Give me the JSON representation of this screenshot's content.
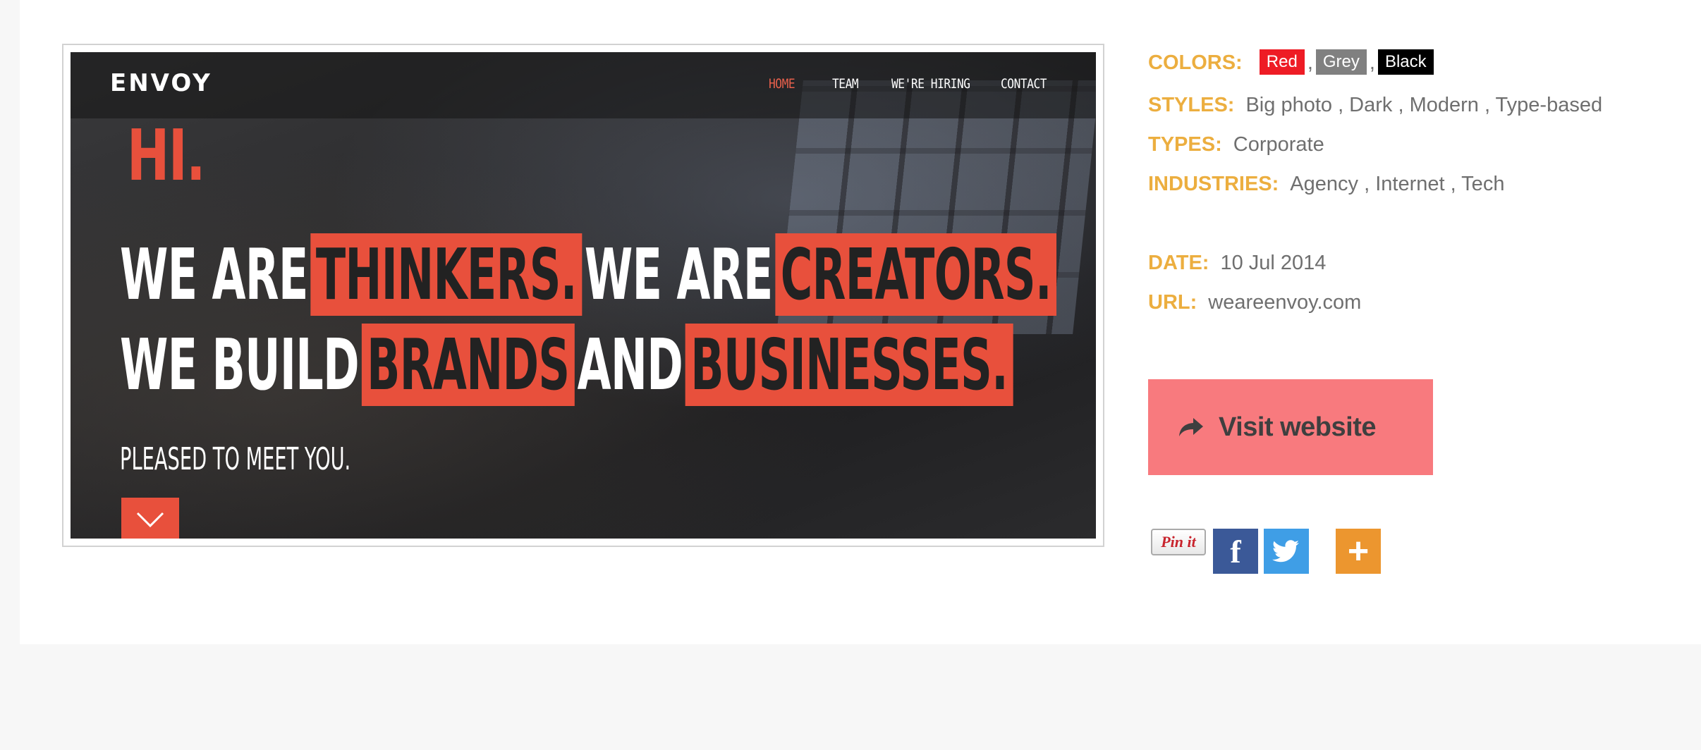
{
  "preview": {
    "logo": "ENVOY",
    "nav": [
      "HOME",
      "TEAM",
      "WE'RE HIRING",
      "CONTACT"
    ],
    "active_nav": "HOME",
    "hero_hi": "HI.",
    "line1": [
      "WE ARE",
      "THINKERS.",
      "WE ARE",
      "CREATORS."
    ],
    "line2": [
      "WE BUILD",
      "BRANDS",
      "AND",
      "BUSINESSES."
    ],
    "subline": "PLEASED TO MEET YOU.",
    "accent": "#e8503c"
  },
  "meta": {
    "colors_label": "COLORS:",
    "colors": [
      {
        "name": "Red",
        "hex": "#ee1c25"
      },
      {
        "name": "Grey",
        "hex": "#808080"
      },
      {
        "name": "Black",
        "hex": "#000000"
      }
    ],
    "styles_label": "STYLES:",
    "styles": "Big photo , Dark , Modern , Type-based",
    "types_label": "TYPES:",
    "types": "Corporate",
    "industries_label": "INDUSTRIES:",
    "industries": "Agency , Internet , Tech",
    "date_label": "DATE:",
    "date": "10 Jul 2014",
    "url_label": "URL:",
    "url": "weareenvoy.com"
  },
  "visit": {
    "label": "Visit website",
    "icon": "share-arrow-icon",
    "bg": "#f87a7e"
  },
  "social": {
    "pinterest_label": "Pin it",
    "facebook": "#3b5998",
    "twitter": "#3f9ee6",
    "addthis": "#ec962f"
  }
}
